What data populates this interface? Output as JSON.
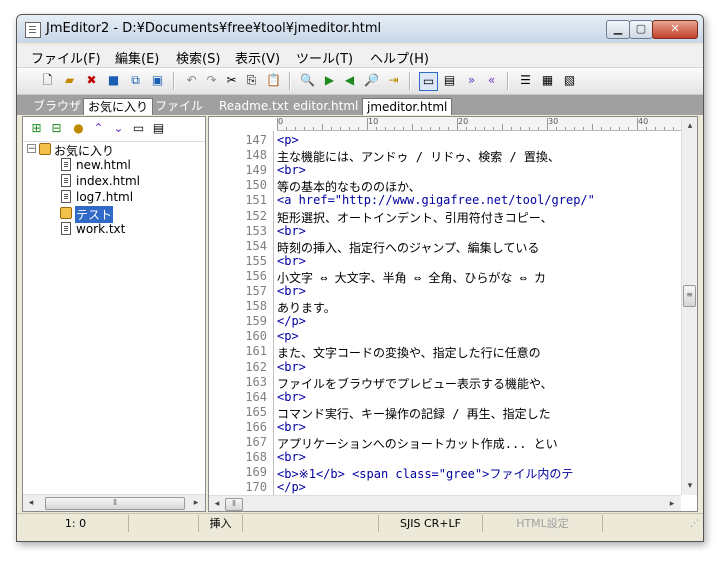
{
  "window": {
    "title": "JmEditor2 - D:¥Documents¥free¥tool¥jmeditor.html"
  },
  "menu": [
    "ファイル(F)",
    "編集(E)",
    "検索(S)",
    "表示(V)",
    "ツール(T)",
    "ヘルプ(H)"
  ],
  "toolbar": {
    "icons": [
      "new-file-icon",
      "open-folder-icon",
      "close-file-icon",
      "save-icon",
      "save-all-icon",
      "save-as-icon",
      "undo-icon",
      "redo-icon",
      "cut-icon",
      "copy-icon",
      "paste-icon",
      "find-icon",
      "find-next-icon",
      "find-prev-icon",
      "replace-icon",
      "jump-icon",
      "pane-single-icon",
      "pane-split-icon",
      "forward-icon",
      "back-icon",
      "list-icon",
      "properties-icon",
      "preview-icon"
    ]
  },
  "left_tabs": [
    "ブラウザ",
    "お気に入り",
    "ファイル"
  ],
  "doc_tabs": [
    "Readme.txt",
    "editor.html",
    "jmeditor.html"
  ],
  "favorites": {
    "root": "お気に入り",
    "items": [
      "new.html",
      "index.html",
      "log7.html",
      "テスト",
      "work.txt"
    ]
  },
  "ruler": {
    "labels": [
      "0",
      "10",
      "20",
      "30",
      "40"
    ]
  },
  "editor": {
    "lines": [
      {
        "n": "147",
        "text": "<p>"
      },
      {
        "n": "148",
        "text": "主な機能には、アンドゥ / リドゥ、検索 / 置換、"
      },
      {
        "n": "149",
        "text": "<br>"
      },
      {
        "n": "150",
        "text": "等の基本的なもののほか、"
      },
      {
        "n": "151",
        "text": "<a href=\"http://www.gigafree.net/tool/grep/\""
      },
      {
        "n": "152",
        "text": "矩形選択、オートインデント、引用符付きコピー、"
      },
      {
        "n": "153",
        "text": "<br>"
      },
      {
        "n": "154",
        "text": "時刻の挿入、指定行へのジャンプ、編集している"
      },
      {
        "n": "155",
        "text": "<br>"
      },
      {
        "n": "156",
        "text": "小文字 ⇔ 大文字、半角 ⇔ 全角、ひらがな ⇔ カ"
      },
      {
        "n": "157",
        "text": "<br>"
      },
      {
        "n": "158",
        "text": "あります。"
      },
      {
        "n": "159",
        "text": "</p>"
      },
      {
        "n": "160",
        "text": "<p>"
      },
      {
        "n": "161",
        "text": "また、文字コードの変換や、指定した行に任意の"
      },
      {
        "n": "162",
        "text": "<br>"
      },
      {
        "n": "163",
        "text": "ファイルをブラウザでプレビュー表示する機能や、"
      },
      {
        "n": "164",
        "text": "<br>"
      },
      {
        "n": "165",
        "text": "コマンド実行、キー操作の記録 / 再生、指定した"
      },
      {
        "n": "166",
        "text": "<br>"
      },
      {
        "n": "167",
        "text": "アプリケーションへのショートカット作成... とい"
      },
      {
        "n": "168",
        "text": "<br>"
      },
      {
        "n": "169",
        "text": "<b>※1</b> <span class=\"gree\">ファイル内のテ"
      },
      {
        "n": "170",
        "text": "</p>"
      }
    ]
  },
  "status": {
    "position": "1: 0",
    "mode": "挿入",
    "encoding": "SJIS CR+LF",
    "settings": "HTML設定"
  }
}
